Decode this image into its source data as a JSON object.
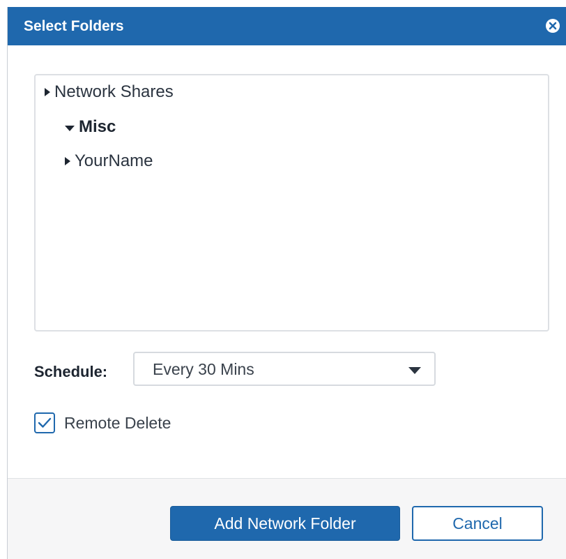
{
  "dialog": {
    "title": "Select Folders",
    "close_icon": "close-circle-icon"
  },
  "tree": {
    "items": [
      {
        "label": "Network Shares",
        "expanded": false,
        "bold": false,
        "level": 0
      },
      {
        "label": "Misc",
        "expanded": true,
        "bold": true,
        "level": 1
      },
      {
        "label": "YourName",
        "expanded": false,
        "bold": false,
        "level": 1
      }
    ]
  },
  "schedule": {
    "label": "Schedule:",
    "selected": "Every 30 Mins"
  },
  "remote_delete": {
    "label": "Remote Delete",
    "checked": true
  },
  "buttons": {
    "add_label": "Add Network Folder",
    "cancel_label": "Cancel"
  },
  "colors": {
    "accent": "#1f68ad",
    "footer_bg": "#f6f6f7",
    "border": "#dde0e4"
  }
}
